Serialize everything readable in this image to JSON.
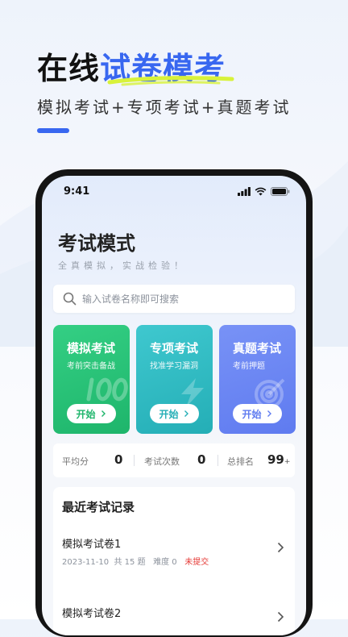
{
  "promo": {
    "title_part1": "在线",
    "title_part2": "试卷模考",
    "subtitle": "模拟考试+专项考试+真题考试",
    "accent_color": "#3867f0"
  },
  "status_bar": {
    "time": "9:41"
  },
  "app": {
    "title": "考试模式",
    "subtitle": "全真模拟，实战检验！",
    "search": {
      "placeholder": "输入试卷名称即可搜索",
      "value": ""
    },
    "modes": [
      {
        "title": "模拟考试",
        "desc": "考前突击备战",
        "button": "开始",
        "color": "#1eb56b"
      },
      {
        "title": "专项考试",
        "desc": "找准学习漏洞",
        "button": "开始",
        "color": "#24aeb6"
      },
      {
        "title": "真题考试",
        "desc": "考前押题",
        "button": "开始",
        "color": "#5f7bf0"
      }
    ],
    "stats": {
      "avg_score_label": "平均分",
      "avg_score": "0",
      "exam_count_label": "考试次数",
      "exam_count": "0",
      "rank_label": "总排名",
      "rank": "99",
      "rank_suffix": "+"
    },
    "records": {
      "title": "最近考试记录",
      "items": [
        {
          "name": "模拟考试卷1",
          "date": "2023-11-10",
          "count": "共 15 题",
          "difficulty": "难度 0",
          "status": "未提交"
        },
        {
          "name": "模拟考试卷2"
        }
      ]
    }
  },
  "icons": [
    "search-icon",
    "signal-icon",
    "wifi-icon",
    "battery-icon",
    "chevron-right-icon"
  ]
}
